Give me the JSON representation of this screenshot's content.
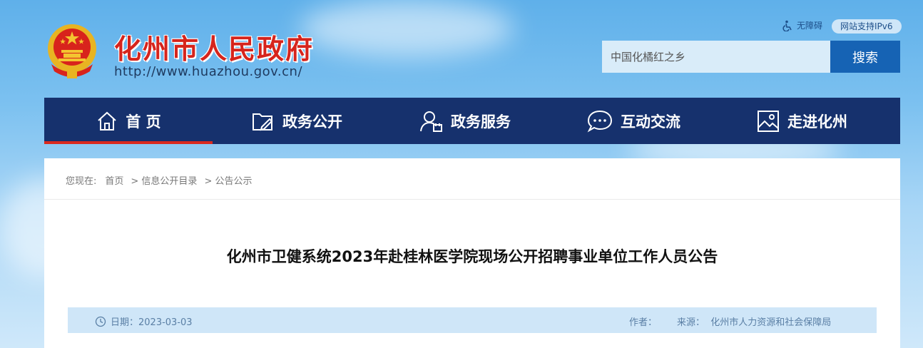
{
  "header": {
    "site_title": "化州市人民政府",
    "site_url": "http://www.huazhou.gov.cn/",
    "accessibility_label": "无障碍",
    "ipv6_label": "网站支持IPv6",
    "search_placeholder": "中国化橘红之乡",
    "search_button": "搜索"
  },
  "nav": {
    "items": [
      {
        "label": "首 页",
        "icon": "home-icon",
        "active": true
      },
      {
        "label": "政务公开",
        "icon": "folder-edit-icon"
      },
      {
        "label": "政务服务",
        "icon": "user-service-icon"
      },
      {
        "label": "互动交流",
        "icon": "chat-bubble-icon"
      },
      {
        "label": "走进化州",
        "icon": "picture-frame-icon"
      }
    ]
  },
  "breadcrumb": {
    "prefix": "您现在:",
    "items": [
      "首页",
      "> 信息公开目录",
      "> 公告公示"
    ]
  },
  "article": {
    "title": "化州市卫健系统2023年赴桂林医学院现场公开招聘事业单位工作人员公告",
    "date": "日期：2023-03-03",
    "author_label": "作者：",
    "source": "来源：  化州市人力资源和社会保障局"
  },
  "colors": {
    "nav_bg": "#16316d",
    "accent_red": "#d92a1e",
    "search_button": "#1663b4",
    "title_red": "#d6241c"
  }
}
